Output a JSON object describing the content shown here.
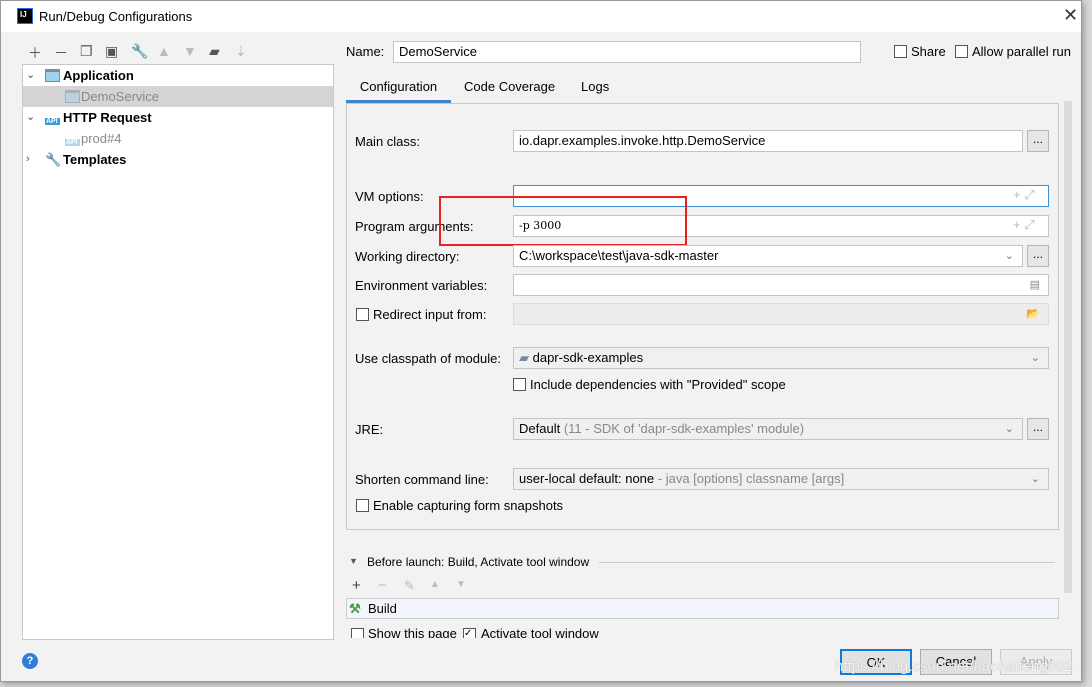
{
  "window": {
    "title": "Run/Debug Configurations",
    "app_icon": "IJ"
  },
  "toolbar": {
    "icons": [
      "plus-icon",
      "minus-icon",
      "copy-icon",
      "save-icon",
      "wrench-icon",
      "arrow-up-icon",
      "arrow-down-icon",
      "new-folder-icon",
      "sort-icon"
    ]
  },
  "tree": {
    "items": [
      {
        "label": "Application",
        "bold": true
      },
      {
        "label": "DemoService",
        "selected": true
      },
      {
        "label": "HTTP Request",
        "bold": true
      },
      {
        "label": "prod#4"
      },
      {
        "label": "Templates",
        "bold": true
      }
    ]
  },
  "name": {
    "label": "Name:",
    "value": "DemoService",
    "share": "Share",
    "allow_parallel": "Allow parallel run"
  },
  "tabs": [
    "Configuration",
    "Code Coverage",
    "Logs"
  ],
  "form": {
    "main_class": {
      "label": "Main class:",
      "value": "io.dapr.examples.invoke.http.DemoService"
    },
    "vm_options": {
      "label": "VM options:",
      "value": ""
    },
    "program_arguments": {
      "label": "Program arguments:",
      "value": "-p 3000"
    },
    "working_directory": {
      "label": "Working directory:",
      "value": "C:\\workspace\\test\\java-sdk-master"
    },
    "environment_variables": {
      "label": "Environment variables:",
      "value": ""
    },
    "redirect_input": {
      "label": "Redirect input from:",
      "checked": false
    },
    "classpath_module": {
      "label": "Use classpath of module:",
      "value": "dapr-sdk-examples"
    },
    "include_provided": {
      "label": "Include dependencies with \"Provided\" scope",
      "checked": false
    },
    "jre": {
      "label": "JRE:",
      "value": "Default",
      "hint": "(11 - SDK of 'dapr-sdk-examples' module)"
    },
    "shorten": {
      "label": "Shorten command line:",
      "value": "user-local default: none",
      "hint": "- java [options] classname [args]"
    },
    "enable_snapshots": {
      "label": "Enable capturing form snapshots",
      "checked": false
    },
    "browse": "..."
  },
  "before_launch": {
    "title": "Before launch: Build, Activate tool window",
    "items": [
      "Build"
    ],
    "show_page": "Show this page",
    "activate_tool": "Activate tool window"
  },
  "buttons": {
    "ok": "OK",
    "cancel": "Cancel",
    "apply": "Apply"
  },
  "watermark": "https://blog.csdn.net/haohaifeng002",
  "colors": {
    "highlight": "#e8211f",
    "focus": "#3d8fd6"
  }
}
